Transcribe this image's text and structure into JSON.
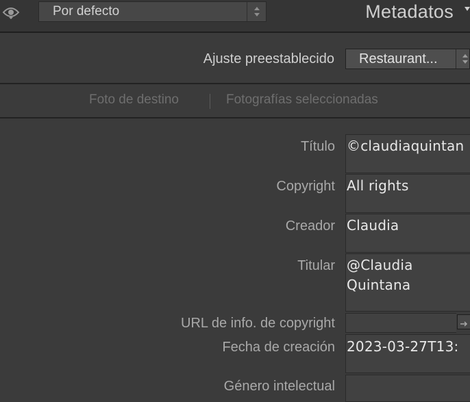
{
  "header": {
    "preset_select_value": "Por defecto",
    "panel_title": "Metadatos"
  },
  "preset_row": {
    "label": "Ajuste preestablecido",
    "value": "Restaurant..."
  },
  "tabs": [
    {
      "label": "Foto de destino"
    },
    {
      "label": "Fotografías seleccionadas"
    }
  ],
  "fields": {
    "titulo": {
      "label": "Título",
      "value": "©claudiaquintan"
    },
    "copyright": {
      "label": "Copyright",
      "value": "All rights"
    },
    "creador": {
      "label": "Creador",
      "value": "Claudia"
    },
    "titular": {
      "label": "Titular",
      "value_line1": "@Claudia",
      "value_line2": "Quintana"
    },
    "url": {
      "label": "URL de info. de copyright",
      "value": ""
    },
    "fecha": {
      "label": "Fecha de creación",
      "value": "2023-03-27T13:"
    },
    "genero": {
      "label": "Género intelectual",
      "value": ""
    }
  },
  "icons": {
    "visibility": "eye-icon",
    "stepper": "updown-arrows-icon",
    "link": "arrow-right-icon"
  },
  "colors": {
    "background": "#3b3b3b",
    "field_bg": "#414141",
    "text": "#e8e8e8",
    "label": "#a9a9a9"
  }
}
